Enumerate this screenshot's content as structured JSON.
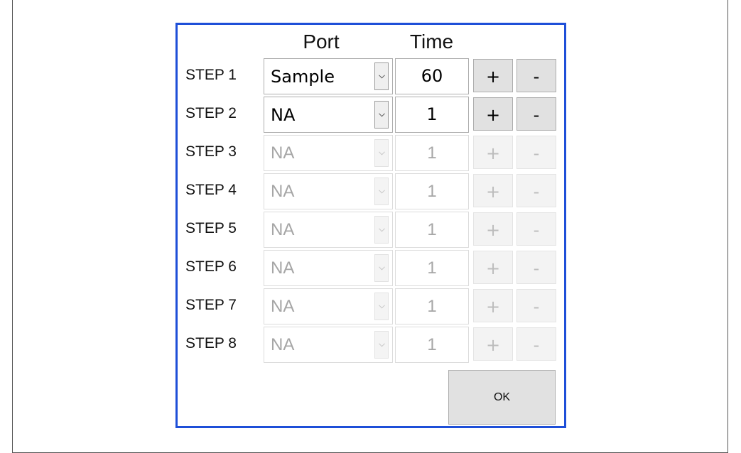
{
  "header": {
    "port_label": "Port",
    "time_label": "Time"
  },
  "steps": [
    {
      "label": "STEP 1",
      "port": "Sample",
      "time": "60",
      "plus": "+",
      "minus": "-",
      "enabled": true
    },
    {
      "label": "STEP 2",
      "port": "NA",
      "time": "1",
      "plus": "+",
      "minus": "-",
      "enabled": true
    },
    {
      "label": "STEP 3",
      "port": "NA",
      "time": "1",
      "plus": "+",
      "minus": "-",
      "enabled": false
    },
    {
      "label": "STEP 4",
      "port": "NA",
      "time": "1",
      "plus": "+",
      "minus": "-",
      "enabled": false
    },
    {
      "label": "STEP 5",
      "port": "NA",
      "time": "1",
      "plus": "+",
      "minus": "-",
      "enabled": false
    },
    {
      "label": "STEP 6",
      "port": "NA",
      "time": "1",
      "plus": "+",
      "minus": "-",
      "enabled": false
    },
    {
      "label": "STEP 7",
      "port": "NA",
      "time": "1",
      "plus": "+",
      "minus": "-",
      "enabled": false
    },
    {
      "label": "STEP 8",
      "port": "NA",
      "time": "1",
      "plus": "+",
      "minus": "-",
      "enabled": false
    }
  ],
  "ok_button": {
    "label": "OK"
  },
  "icons": {
    "dropdown": "chevron-down-icon"
  },
  "colors": {
    "dialog_border": "#1e4fd8",
    "button_bg": "#e1e1e1",
    "disabled_text": "#a6a6a6"
  }
}
